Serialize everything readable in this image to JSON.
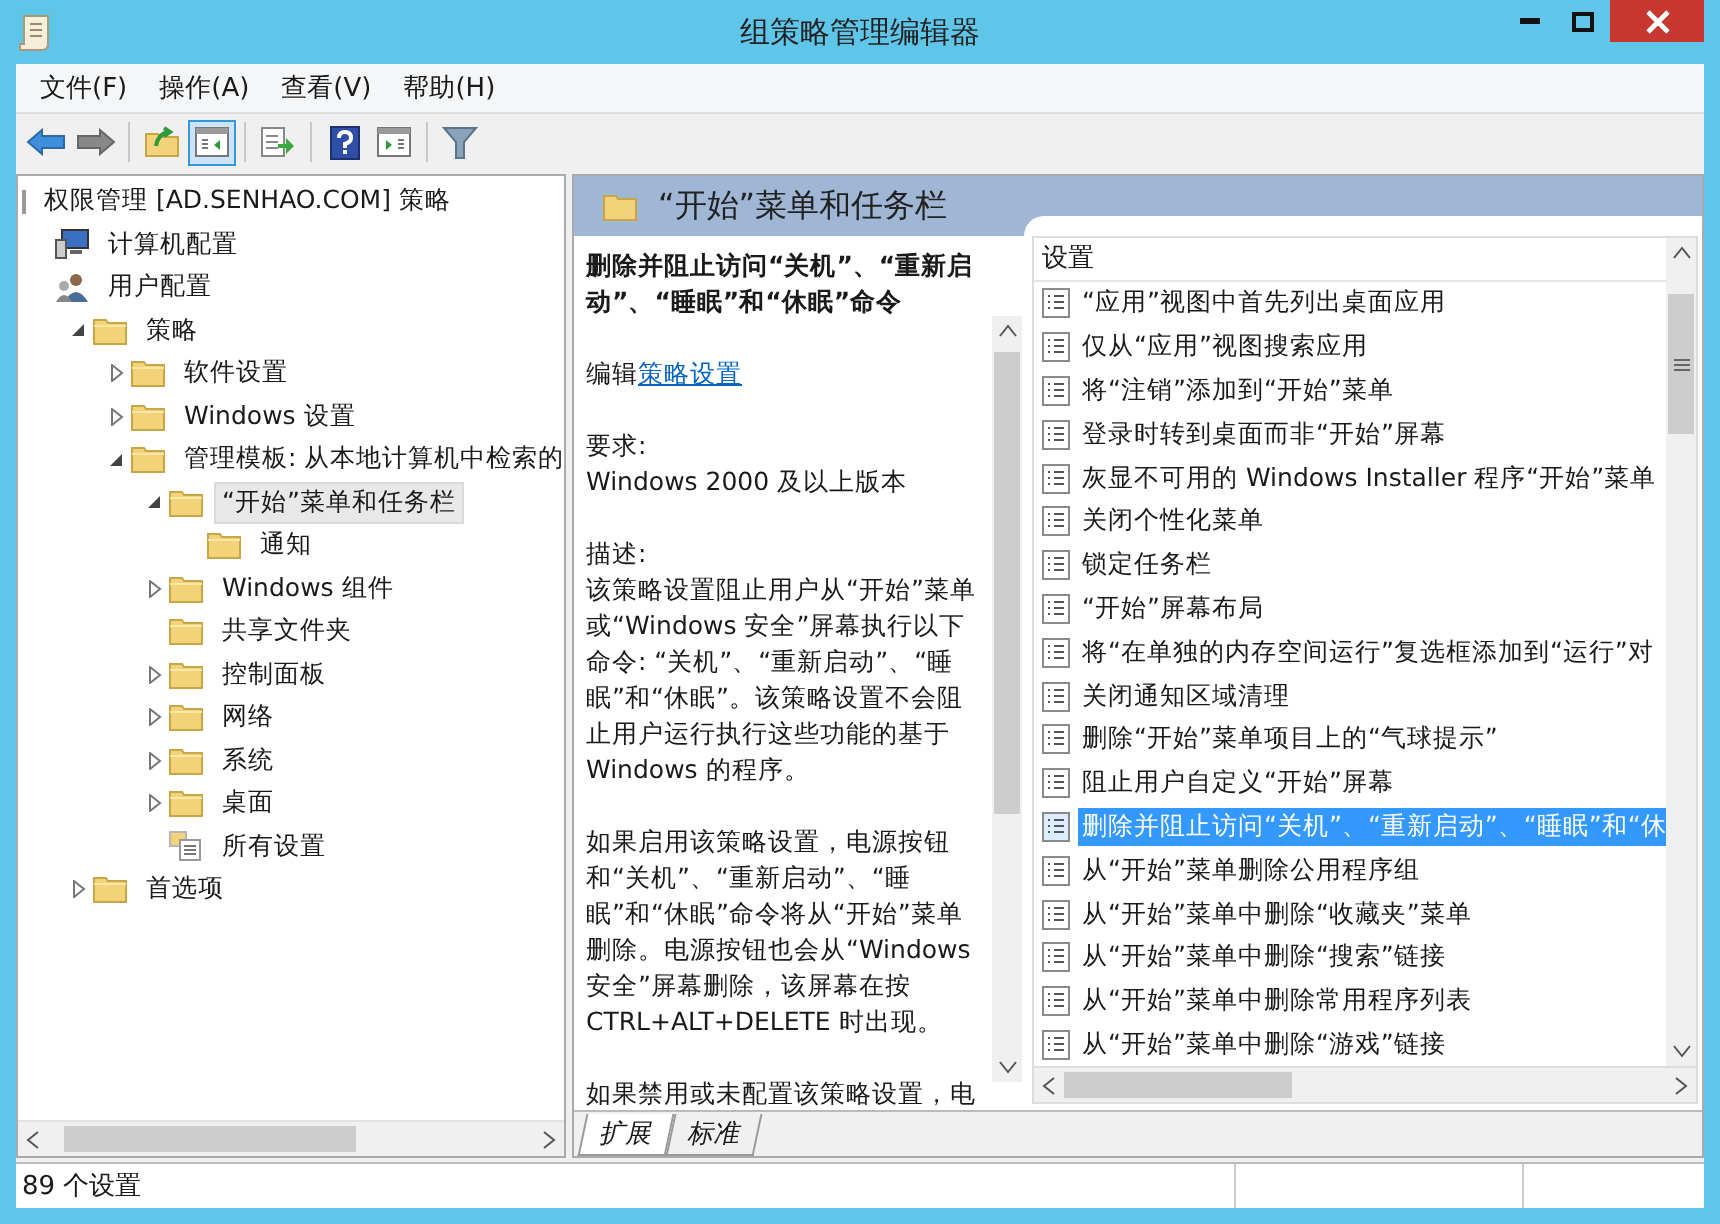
{
  "window": {
    "title": "组策略管理编辑器"
  },
  "menu": [
    "文件(F)",
    "操作(A)",
    "查看(V)",
    "帮助(H)"
  ],
  "toolbar": [
    [
      {
        "kind": "back",
        "pressed": false
      },
      {
        "kind": "forward",
        "pressed": false
      }
    ],
    [
      {
        "kind": "up",
        "pressed": false
      },
      {
        "kind": "tree",
        "pressed": true
      }
    ],
    [
      {
        "kind": "export",
        "pressed": false
      }
    ],
    [
      {
        "kind": "help",
        "pressed": false
      },
      {
        "kind": "pane",
        "pressed": false
      }
    ],
    [
      {
        "kind": "filter",
        "pressed": false
      }
    ]
  ],
  "tree": [
    {
      "label": "权限管理 [AD.SENHAO.COM] 策略",
      "kind": "gpo",
      "selected": false,
      "children": [
        {
          "label": "计算机配置",
          "kind": "computer",
          "selected": false
        },
        {
          "label": "用户配置",
          "kind": "user",
          "selected": false,
          "children": [
            {
              "label": "策略",
              "kind": "folder",
              "expanded": true,
              "selected": false,
              "children": [
                {
                  "label": "软件设置",
                  "kind": "folder",
                  "expanded": false,
                  "selected": false
                },
                {
                  "label": "Windows 设置",
                  "kind": "folder",
                  "expanded": false,
                  "selected": false
                },
                {
                  "label": "管理模板: 从本地计算机中检索的",
                  "kind": "folder",
                  "expanded": true,
                  "selected": false,
                  "children": [
                    {
                      "label": "“开始”菜单和任务栏",
                      "kind": "folder",
                      "expanded": true,
                      "selected": true,
                      "children": [
                        {
                          "label": "通知",
                          "kind": "folder",
                          "selected": false
                        }
                      ]
                    },
                    {
                      "label": "Windows 组件",
                      "kind": "folder",
                      "expanded": false,
                      "selected": false
                    },
                    {
                      "label": "共享文件夹",
                      "kind": "folder",
                      "selected": false
                    },
                    {
                      "label": "控制面板",
                      "kind": "folder",
                      "expanded": false,
                      "selected": false
                    },
                    {
                      "label": "网络",
                      "kind": "folder",
                      "expanded": false,
                      "selected": false
                    },
                    {
                      "label": "系统",
                      "kind": "folder",
                      "expanded": false,
                      "selected": false
                    },
                    {
                      "label": "桌面",
                      "kind": "folder",
                      "expanded": false,
                      "selected": false
                    },
                    {
                      "label": "所有设置",
                      "kind": "all",
                      "selected": false
                    }
                  ]
                }
              ]
            },
            {
              "label": "首选项",
              "kind": "folder",
              "expanded": false,
              "selected": false
            }
          ]
        }
      ]
    }
  ],
  "details": {
    "header": "“开始”菜单和任务栏",
    "title": "删除并阻止访问“关机”、“重新启动”、“睡眠”和“休眠”命令",
    "edit_prefix": "编辑",
    "edit_link": "策略设置",
    "requirements_label": "要求:",
    "requirements": "Windows 2000 及以上版本",
    "description_label": "描述:",
    "paragraphs": [
      "该策略设置阻止用户从“开始”菜单或“Windows 安全”屏幕执行以下命令: “关机”、“重新启动”、“睡眠”和“休眠”。该策略设置不会阻止用户运行执行这些功能的基于 Windows 的程序。",
      "如果启用该策略设置，电源按钮和“关机”、“重新启动”、“睡眠”和“休眠”命令将从“开始”菜单删除。电源按钮也会从“Windows 安全”屏幕删除，该屏幕在按 CTRL+ALT+DELETE 时出现。",
      "如果禁用或未配置该策略设置，电"
    ]
  },
  "settings": {
    "column": "设置",
    "rows": [
      {
        "label": "“应用”视图中首先列出桌面应用",
        "selected": false
      },
      {
        "label": "仅从“应用”视图搜索应用",
        "selected": false
      },
      {
        "label": "将“注销”添加到“开始”菜单",
        "selected": false
      },
      {
        "label": "登录时转到桌面而非“开始”屏幕",
        "selected": false
      },
      {
        "label": "灰显不可用的 Windows Installer 程序“开始”菜单",
        "selected": false
      },
      {
        "label": "关闭个性化菜单",
        "selected": false
      },
      {
        "label": "锁定任务栏",
        "selected": false
      },
      {
        "label": "“开始”屏幕布局",
        "selected": false
      },
      {
        "label": "将“在单独的内存空间运行”复选框添加到“运行”对",
        "selected": false
      },
      {
        "label": "关闭通知区域清理",
        "selected": false
      },
      {
        "label": "删除“开始”菜单项目上的“气球提示”",
        "selected": false
      },
      {
        "label": "阻止用户自定义“开始”屏幕",
        "selected": false
      },
      {
        "label": "删除并阻止访问“关机”、“重新启动”、“睡眠”和“休",
        "selected": true
      },
      {
        "label": "从“开始”菜单删除公用程序组",
        "selected": false
      },
      {
        "label": "从“开始”菜单中删除“收藏夹”菜单",
        "selected": false
      },
      {
        "label": "从“开始”菜单中删除“搜索”链接",
        "selected": false
      },
      {
        "label": "从“开始”菜单中删除常用程序列表",
        "selected": false
      },
      {
        "label": "从“开始”菜单中删除“游戏”链接",
        "selected": false
      }
    ]
  },
  "tabs": [
    {
      "label": "扩展",
      "selected": true
    },
    {
      "label": "标准",
      "selected": false
    }
  ],
  "status_bar": "89 个设置"
}
